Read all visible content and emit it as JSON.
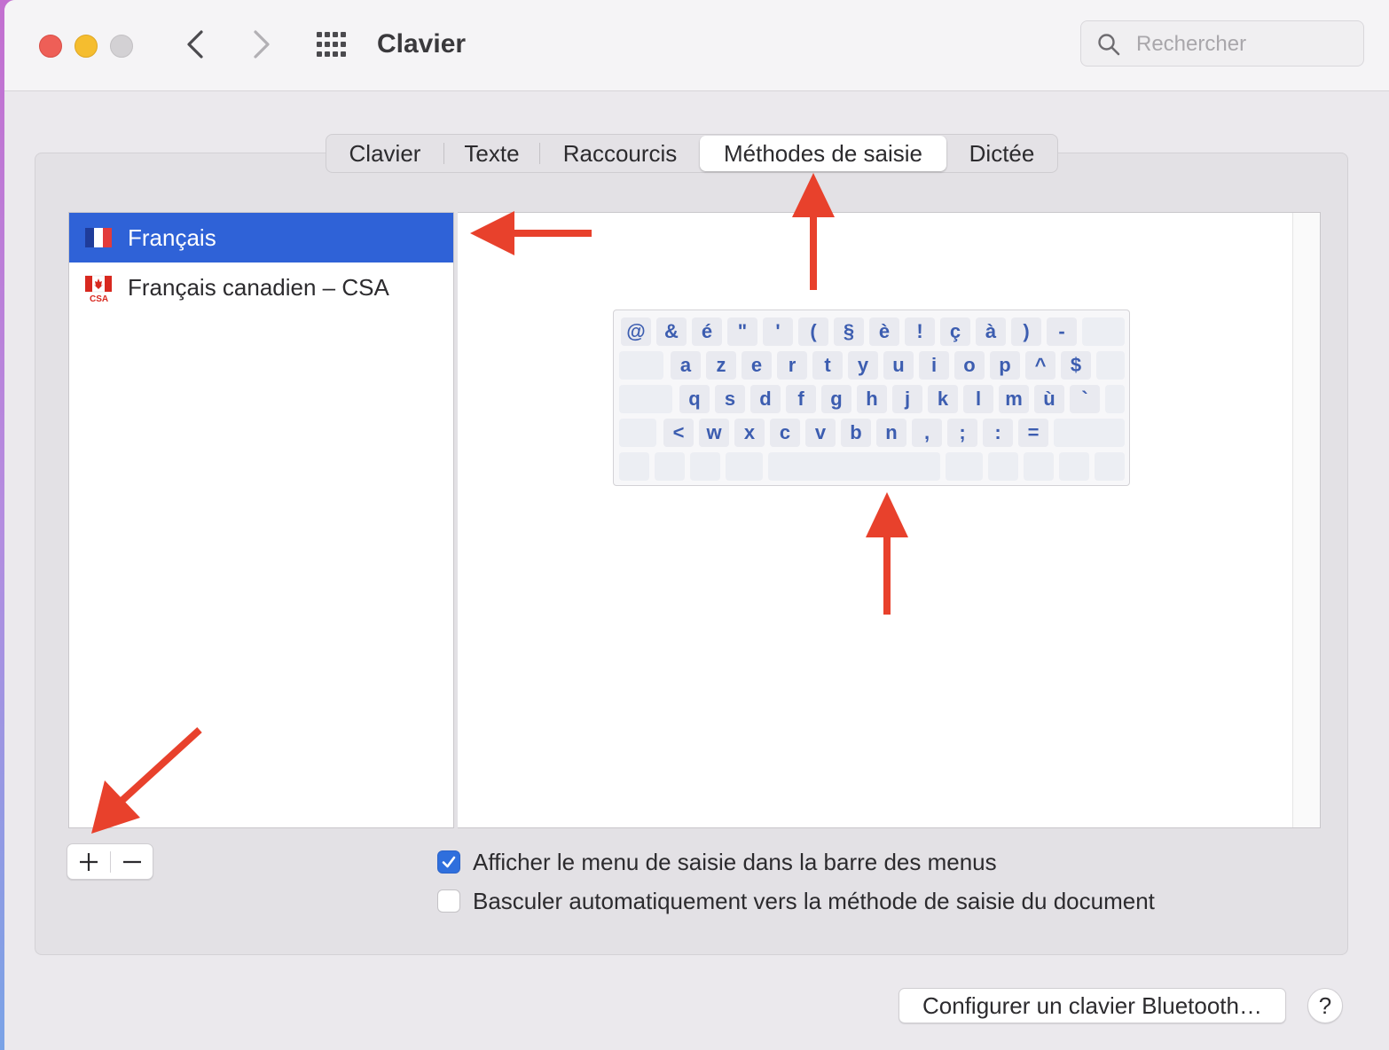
{
  "window": {
    "title": "Clavier"
  },
  "search": {
    "placeholder": "Rechercher"
  },
  "tabs": [
    {
      "label": "Clavier"
    },
    {
      "label": "Texte"
    },
    {
      "label": "Raccourcis"
    },
    {
      "label": "Méthodes de saisie",
      "selected": true
    },
    {
      "label": "Dictée"
    }
  ],
  "input_sources": [
    {
      "label": "Français",
      "flag": "france-flag-icon",
      "selected": true
    },
    {
      "label": "Français canadien – CSA",
      "flag": "canada-csa-flag-icon",
      "flag_caption": "CSA"
    }
  ],
  "keyboard_rows": [
    [
      "@",
      "&",
      "é",
      "\"",
      "'",
      "(",
      "§",
      "è",
      "!",
      "ç",
      "à",
      ")",
      "-"
    ],
    [
      "a",
      "z",
      "e",
      "r",
      "t",
      "y",
      "u",
      "i",
      "o",
      "p",
      "^",
      "$"
    ],
    [
      "q",
      "s",
      "d",
      "f",
      "g",
      "h",
      "j",
      "k",
      "l",
      "m",
      "ù",
      "`"
    ],
    [
      "<",
      "w",
      "x",
      "c",
      "v",
      "b",
      "n",
      ",",
      ";",
      ":",
      "="
    ]
  ],
  "checkboxes": [
    {
      "label": "Afficher le menu de saisie dans la barre des menus",
      "checked": true
    },
    {
      "label": "Basculer automatiquement vers la méthode de saisie du document",
      "checked": false
    }
  ],
  "buttons": {
    "bluetooth": "Configurer un clavier Bluetooth…",
    "help": "?"
  },
  "colors": {
    "selection": "#2f62d7",
    "checkbox_accent": "#2f6fdd",
    "annotation_arrow": "#e8412c",
    "key_text": "#3c5db0"
  }
}
